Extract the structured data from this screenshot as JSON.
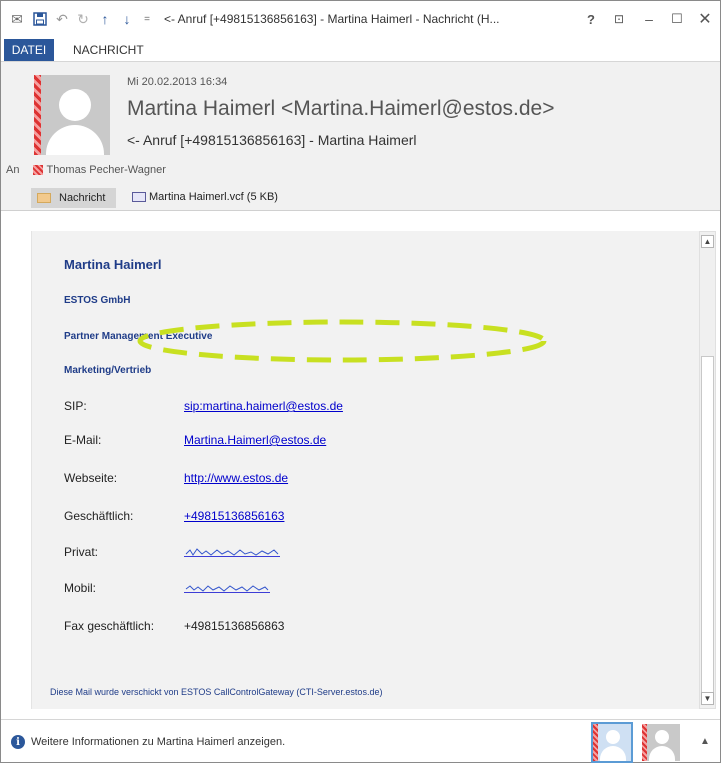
{
  "window": {
    "title": "<- Anruf [+49815136856163] - Martina Haimerl - Nachricht (H...",
    "help": "?",
    "ribbon_options": "⊡",
    "minimize": "–",
    "maximize": "☐",
    "close": "✕"
  },
  "quick_access": {
    "envelope": "✉",
    "save": "💾",
    "undo": "↶",
    "redo": "↻",
    "previous": "↑",
    "next": "↓",
    "customize": "="
  },
  "ribbon": {
    "tabs": [
      "DATEI",
      "NACHRICHT"
    ]
  },
  "header": {
    "date": "Mi 20.02.2013 16:34",
    "sender": "Martina Haimerl <Martina.Haimerl@estos.de>",
    "subject": "<- Anruf [+49815136856163] - Martina Haimerl",
    "to_label": "An",
    "to_name": "Thomas Pecher-Wagner"
  },
  "attachments": {
    "message_tab": "Nachricht",
    "vcf": "Martina Haimerl.vcf (5 KB)"
  },
  "contact": {
    "name": "Martina Haimerl",
    "company": "ESTOS GmbH",
    "role": "Partner Management Executive",
    "department": "Marketing/Vertrieb",
    "rows": [
      {
        "label": "SIP:",
        "value": "sip:martina.haimerl@estos.de"
      },
      {
        "label": "E-Mail:",
        "value": "Martina.Haimerl@estos.de"
      },
      {
        "label": "Webseite:",
        "value": "http://www.estos.de"
      },
      {
        "label": "Geschäftlich:",
        "value": "+49815136856163"
      },
      {
        "label": "Privat:",
        "value": ""
      },
      {
        "label": "Mobil:",
        "value": ""
      },
      {
        "label": "Fax geschäftlich:",
        "value": "+49815136856863"
      }
    ],
    "footer": "Diese Mail wurde verschickt von ESTOS CallControlGateway (CTI-Server.estos.de)"
  },
  "scroll": {
    "up": "▲",
    "down": "▼"
  },
  "infobar": {
    "icon": "i",
    "text": "Weitere Informationen zu Martina Haimerl anzeigen.",
    "collapse": "▲"
  },
  "colors": {
    "accent": "#2b579a",
    "link": "#0000cc",
    "contact_text": "#1f3c88",
    "highlight": "#c8e021",
    "presence_busy": "#dd3333"
  }
}
